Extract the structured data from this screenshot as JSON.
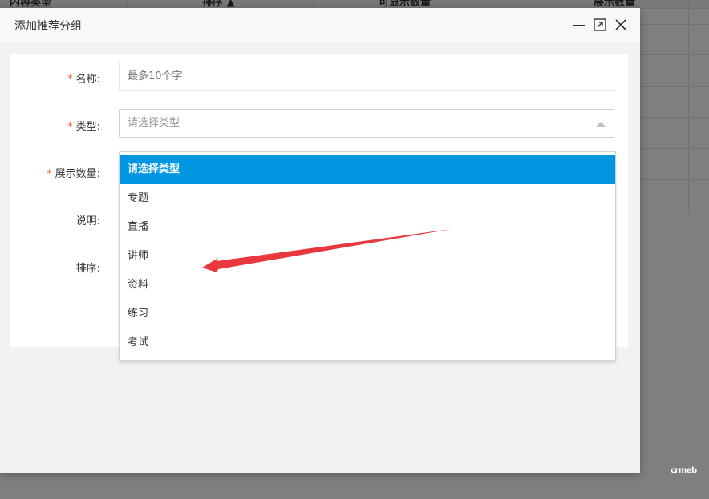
{
  "background": {
    "columns": [
      "内容类型",
      "排序 ▲",
      "可显示数量",
      "展示数量"
    ],
    "watermark": "crmeb"
  },
  "modal": {
    "title": "添加推荐分组",
    "buttons": {
      "minimize": "minimize-icon",
      "maximize": "maximize-icon",
      "close": "close-icon"
    }
  },
  "form": {
    "name": {
      "label": "名称:",
      "placeholder": "最多10个字",
      "required": "*"
    },
    "type": {
      "label": "类型:",
      "placeholder": "请选择类型",
      "required": "*"
    },
    "display_count": {
      "label": "展示数量:",
      "required": "*"
    },
    "description": {
      "label": "说明:"
    },
    "sort": {
      "label": "排序:"
    }
  },
  "dropdown": {
    "options": [
      "请选择类型",
      "专题",
      "直播",
      "讲师",
      "资料",
      "练习",
      "考试"
    ],
    "selected_index": 0
  },
  "colors": {
    "accent": "#0096e1",
    "required": "#ff5722",
    "arrow": "#e8383d"
  }
}
